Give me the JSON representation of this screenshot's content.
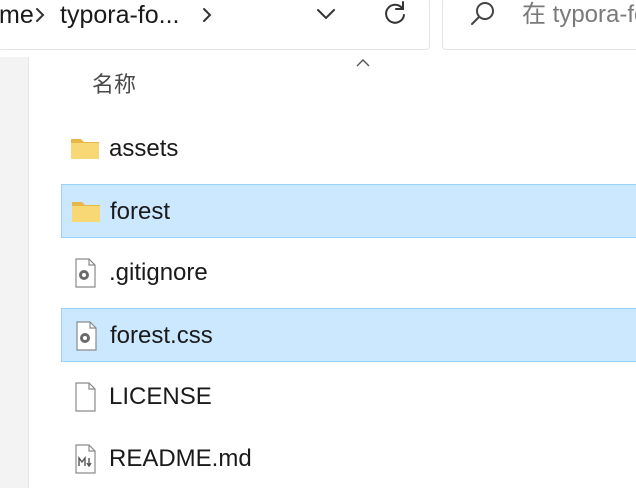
{
  "breadcrumb": {
    "partial": "me",
    "current": "typora-fo..."
  },
  "search": {
    "placeholder": "在 typora-fo"
  },
  "column_header": {
    "name": "名称"
  },
  "files": [
    {
      "name": "assets",
      "type": "folder",
      "selected": false
    },
    {
      "name": "forest",
      "type": "folder",
      "selected": true
    },
    {
      "name": ".gitignore",
      "type": "settings-file",
      "selected": false
    },
    {
      "name": "forest.css",
      "type": "settings-file",
      "selected": true
    },
    {
      "name": "LICENSE",
      "type": "blank-file",
      "selected": false
    },
    {
      "name": "README.md",
      "type": "markdown-file",
      "selected": false
    }
  ],
  "colors": {
    "selection": "#cce8ff",
    "selection_border": "#99d1ff",
    "folder": "#f8d775"
  }
}
